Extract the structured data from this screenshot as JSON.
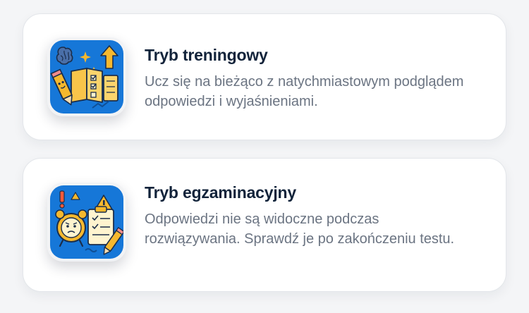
{
  "modes": [
    {
      "title": "Tryb treningowy",
      "description": "Ucz się na bieżąco z natychmiastowym podglądem odpowiedzi i wyjaśnieniami.",
      "icon": "training-illustration-icon",
      "tile_color": "#1677d8"
    },
    {
      "title": "Tryb egzaminacyjny",
      "description": "Odpowiedzi nie są widoczne podczas rozwiązywania. Sprawdź je po zakończeniu testu.",
      "icon": "exam-illustration-icon",
      "tile_color": "#1677d8"
    }
  ],
  "colors": {
    "background": "#f4f5f7",
    "card": "#ffffff",
    "title": "#12233a",
    "description": "#6b7482",
    "accent_yellow": "#f5b82e"
  }
}
